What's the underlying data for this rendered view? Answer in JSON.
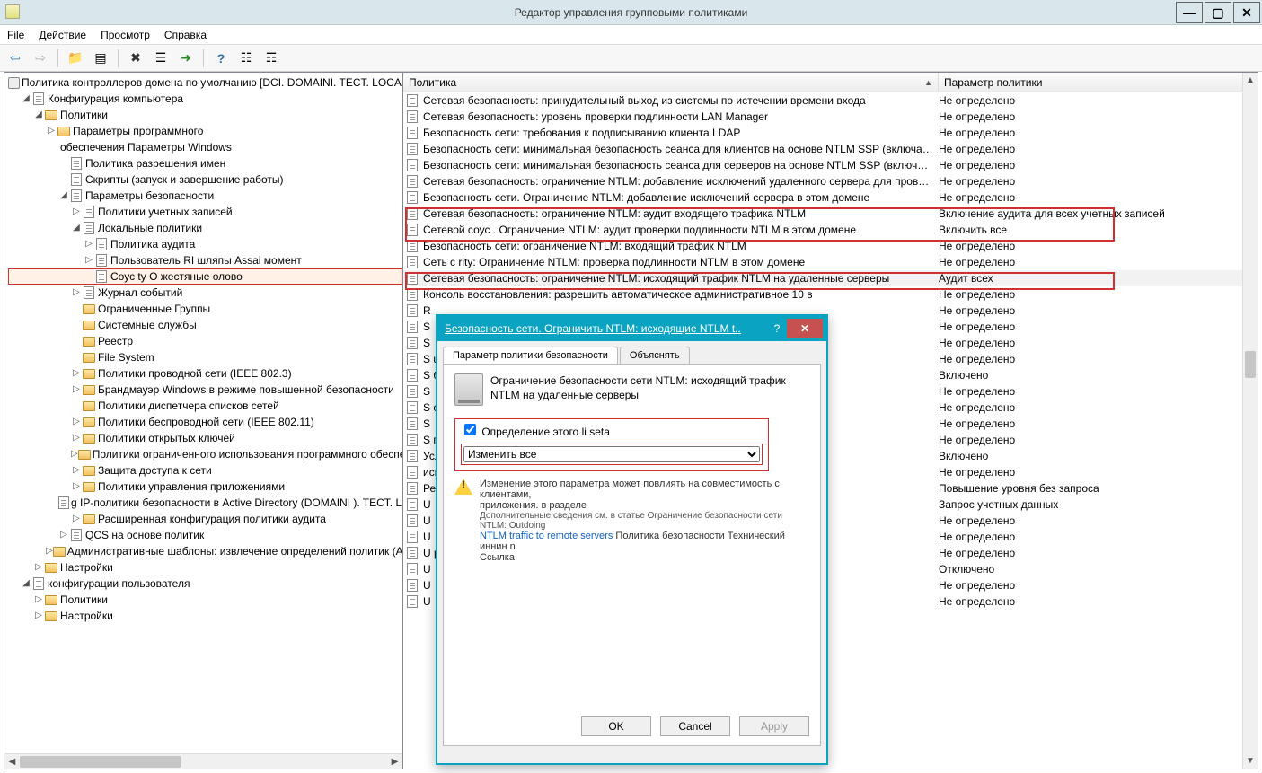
{
  "window": {
    "title": "Редактор управления групповыми политиками",
    "min": "—",
    "max": "▢",
    "close": "✕"
  },
  "menu": {
    "file": "File",
    "action": "Действие",
    "view": "Просмотр",
    "help": "Справка"
  },
  "toolbar": {
    "back": "⇦",
    "fwd": "⇨",
    "up": "📁",
    "list": "▤",
    "delete": "✖",
    "props": "☰",
    "export": "➜",
    "help": "?",
    "filter1": "☷",
    "filter2": "☶"
  },
  "tree": {
    "root": "Политика контроллеров домена по умолчанию [DCI. DOMAINI. TECT. LOCAL] Политика",
    "n1": "Конфигурация компьютера",
    "n1_1": "Политики",
    "n1_1_1": "Параметры программного",
    "n1_1_2_pre": "обеспечения Параметры Windows",
    "n1_1_2_a": "Политика разрешения имен",
    "n1_1_2_b": "Скрипты (запуск и завершение работы)",
    "n1_1_2_c": "Параметры безопасности",
    "sec_a": "Политики учетных записей",
    "sec_b": "Локальные политики",
    "sec_b_1": "Политика аудита",
    "sec_b_2": "Пользователь RI шляпы Assai момент",
    "sec_b_3": "Соус ty О жестяные олово",
    "sec_c": "Журнал событий",
    "sec_d": "Ограниченные Группы",
    "sec_e": "Системные службы",
    "sec_f": "Реестр",
    "sec_g": "File System",
    "sec_h": "Политики проводной сети (IEEE 802.3)",
    "sec_i": "Брандмауэр Windows в режиме повышенной безопасности",
    "sec_j": "Политики диспетчера списков сетей",
    "sec_k": "Политики беспроводной сети (IEEE 802.11)",
    "sec_l": "Политики открытых ключей",
    "sec_m": "Политики ограниченного использования программного обеспечения",
    "sec_n": "Защита доступа к сети",
    "sec_o": "Политики управления приложениями",
    "sec_p": "g IP-политики безопасности в Active Directory (DOMAINI ). TECT. LC",
    "sec_q": "Расширенная конфигурация политики аудита",
    "qos": "QCS на основе политик",
    "adm": "Административные шаблоны: извлечение определений политик (ADMX-файлов)",
    "pref": "Настройки",
    "n2": "конфигурации пользователя",
    "n2_1": "Политики",
    "n2_2": "Настройки"
  },
  "list": {
    "col_policy": "Политика",
    "col_param": "Параметр политики",
    "rows": [
      {
        "p": "Сетевая безопасность: принудительный выход из системы по истечении времени входа",
        "v": "Не определено"
      },
      {
        "p": "Сетевая безопасность: уровень проверки подлинности LAN Manager",
        "v": "Не определено"
      },
      {
        "p": "Безопасность сети: требования к подписыванию клиента LDAP",
        "v": "Не определено"
      },
      {
        "p": "Безопасность сети: минимальная безопасность сеанса для клиентов на основе NTLM SSP (включая защищенный RPC)",
        "v": "Не определено"
      },
      {
        "p": "Безопасность сети: минимальная безопасность сеанса для серверов на основе NTLM SSP (включая защищенный RPC)",
        "v": "Не определено"
      },
      {
        "p": "Сетевая безопасность: ограничение NTLM: добавление исключений удаленного сервера для проверки подлинности NTLM",
        "v": "Не определено"
      },
      {
        "p": "Безопасность сети. Ограничение NTLM: добавление исключений сервера в этом домене",
        "v": "Не определено"
      },
      {
        "p": "Сетевая безопасность: ограничение NTLM: аудит входящего трафика NTLM",
        "v": "Включение аудита для всех учетных записей"
      },
      {
        "p": "Сетевой соус . Ограничение NTLM: аудит проверки подлинности NTLM в этом домене",
        "v": "Включить все"
      },
      {
        "p": "Безопасность сети: ограничение NTLM: входящий трафик NTLM",
        "v": "Не определено"
      },
      {
        "p": "Сеть с         rity: Ограничение NTLM: проверка подлинности NTLM в этом домене",
        "v": "Не определено"
      },
      {
        "p": "Сетевая безопасность: ограничение NTLM: исходящий трафик NTLM на удаленные серверы",
        "v": "Аудит всех"
      },
      {
        "p": "Консоль восстановления: разрешить автоматическое административное 10 в",
        "v": "Не определено"
      },
      {
        "p": "R",
        "v": "Не определено"
      },
      {
        "p": "S",
        "v": "Не определено"
      },
      {
        "p": "S",
        "v": "Не определено"
      },
      {
        "p": "S                                                                                                                   utter",
        "v": "Не определено"
      },
      {
        "p": "S                                                                                                                   борических",
        "v": "Включено"
      },
      {
        "p": "S",
        "v": "Не определено"
      },
      {
        "p": "S                                                                                                                   ссылок) в",
        "v": "Не определено"
      },
      {
        "p": "S",
        "v": "Не определено"
      },
      {
        "p": "S                                                                                                                   политиках.",
        "v": "Не определено"
      },
      {
        "p": "                                                                                                                    Услуги . и",
        "v": "Включено"
      },
      {
        "p": "                                                                                                        использующих безопасные расположения",
        "v": "Не определено"
      },
      {
        "p": "                                                                                                        Режим утверждения",
        "v": "Повышение уровня без запроса"
      },
      {
        "p": "U",
        "v": "Запрос учетных данных"
      },
      {
        "p": "U",
        "v": "Не определено"
      },
      {
        "p": "U",
        "v": "Не определено"
      },
      {
        "p": "U                                                                                                                 рабочего стола",
        "v": "Не определено"
      },
      {
        "p": "U",
        "v": "Отключено"
      },
      {
        "p": "U",
        "v": "Не определено"
      },
      {
        "p": "U",
        "v": "Не определено"
      }
    ]
  },
  "dialog": {
    "title": "Безопасность сети. Ограничить NTLM: исходящие NTLM t..",
    "tab1": "Параметр политики безопасности",
    "tab2": "Объяснять",
    "policy_label": "Ограничение безопасности сети NTLM: исходящий трафик NTLM на удаленные серверы",
    "checkbox": "Определение этого li seta",
    "select_value": "Изменить все",
    "warn_text_1": "Изменение этого параметра может повлиять на совместимость с клиентами,",
    "warn_text_2": "приложения. в разделе",
    "warn_text_3": "Дополнительные сведения см. в статье Ограничение безопасности сети NTLM: Outdoing",
    "link": "NTLM traffic to remote servers",
    "warn_text_4": "Политика безопасности Технический иннин n",
    "warn_text_5": "Ссылка.",
    "ok": "OK",
    "cancel": "Cancel",
    "apply": "Apply"
  }
}
